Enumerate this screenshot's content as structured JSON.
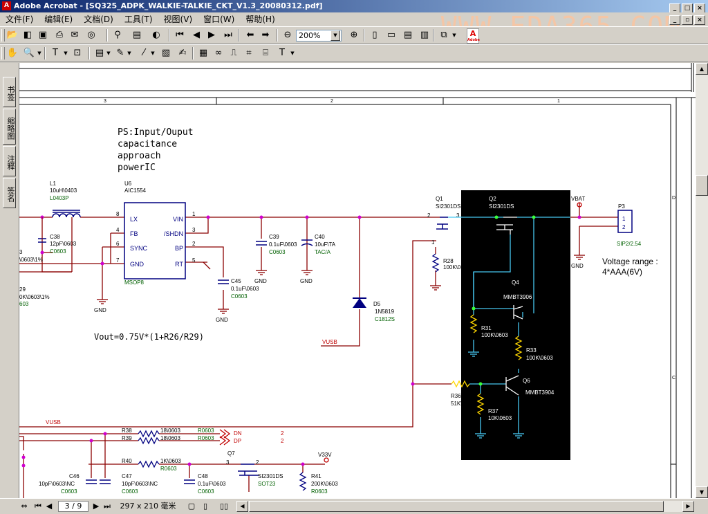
{
  "window": {
    "title": "Adobe Acrobat - [SQ325_ADPK_WALKIE-TALKIE_CKT_V1.3_20080312.pdf]",
    "watermark": "WWW.EDA365.COM"
  },
  "menu": [
    "文件(F)",
    "编辑(E)",
    "文档(D)",
    "工具(T)",
    "视图(V)",
    "窗口(W)",
    "帮助(H)"
  ],
  "toolbar": {
    "zoom": "200%"
  },
  "nav_tabs": [
    "书签",
    "缩略图",
    "注释",
    "签名"
  ],
  "status": {
    "page": "3 / 9",
    "page_size": "297 x 210 毫米"
  },
  "schematic": {
    "ruler": [
      "3",
      "2",
      "1"
    ],
    "side_letters": [
      "D",
      "C"
    ],
    "note_title": "PS:Input/Ouput",
    "note_lines": [
      "capacitance",
      "approach",
      "powerIC"
    ],
    "formula": "Vout=0.75V*(1+R26/R29)",
    "voltage_range_title": "Voltage range :",
    "voltage_range_value": "4*AAA(6V)",
    "nets": {
      "vusb_a": "VUSB",
      "vusb_b": "VUSB",
      "vbat": "VBAT",
      "v33v": "V33V",
      "dn": "DN",
      "dp": "DP",
      "num2a": "2",
      "num2b": "2"
    },
    "gnd": "GND",
    "u6": {
      "ref": "U6",
      "part": "AIC1554",
      "pkg": "MSOP8",
      "pins_left": [
        "LX",
        "FB",
        "SYNC",
        "GND"
      ],
      "pins_right": [
        "VIN",
        "/SHDN",
        "BP",
        "RT"
      ],
      "num_left": [
        "8",
        "4",
        "6",
        "7"
      ],
      "num_right": [
        "1",
        "3",
        "2",
        "5"
      ]
    },
    "l1": {
      "ref": "L1",
      "value": "10uH\\0403",
      "pkg": "L0403P"
    },
    "c38": {
      "ref": "C38",
      "value": "12pF\\0603",
      "pkg": "C0603"
    },
    "clip_left": {
      "a": "3",
      "b": "\\0603\\1%",
      "c": "29",
      "d": "0K\\0603\\1%",
      "e": "603"
    },
    "c39": {
      "ref": "C39",
      "value": "0.1uF\\0603",
      "pkg": "C0603"
    },
    "c40": {
      "ref": "C40",
      "value": "10uF\\TA",
      "pkg": "TAC/A"
    },
    "c45": {
      "ref": "C45",
      "value": "0.1uF\\0603",
      "pkg": "C0603"
    },
    "d5": {
      "ref": "D5",
      "value": "1N5819",
      "pkg": "C1812S"
    },
    "q1": {
      "ref": "Q1",
      "part": "SI2301DS"
    },
    "q2": {
      "ref": "Q2",
      "part": "SI2301DS"
    },
    "q4": {
      "ref": "Q4",
      "part": "MMBT3906"
    },
    "q6": {
      "ref": "Q6",
      "part": "MMBT3904"
    },
    "q7": {
      "ref": "Q7",
      "part": "SI2301DS",
      "pkg": "SOT23"
    },
    "r28": {
      "ref": "R28",
      "value": "100K\\0603"
    },
    "r31": {
      "ref": "R31",
      "value": "100K\\0603"
    },
    "r33": {
      "ref": "R33",
      "value": "100K\\0603"
    },
    "r36": {
      "ref": "R36",
      "value": "51K\\0603"
    },
    "r37": {
      "ref": "R37",
      "value": "10K\\0603"
    },
    "r38": {
      "ref": "R38",
      "value": "18\\0603",
      "pkg": "R0603"
    },
    "r39": {
      "ref": "R39",
      "value": "18\\0603",
      "pkg": "R0603"
    },
    "r40": {
      "ref": "R40",
      "value": "1K\\0603",
      "pkg": "R0603"
    },
    "r41": {
      "ref": "R41",
      "value": "200K\\0603",
      "pkg": "R0603"
    },
    "p3": {
      "ref": "P3",
      "pkg": "SIP2/2.54",
      "pin1": "1",
      "pin2": "2"
    },
    "c46": {
      "ref": "C46",
      "value": "10pF\\0603\\NC",
      "pkg": "C0603"
    },
    "c47": {
      "ref": "C47",
      "value": "10pF\\0603\\NC",
      "pkg": "C0603"
    },
    "c48": {
      "ref": "C48",
      "value": "0.1uF\\0603",
      "pkg": "C0603"
    },
    "pinnums": {
      "p2": "2",
      "p3": "3",
      "p1": "1"
    }
  }
}
